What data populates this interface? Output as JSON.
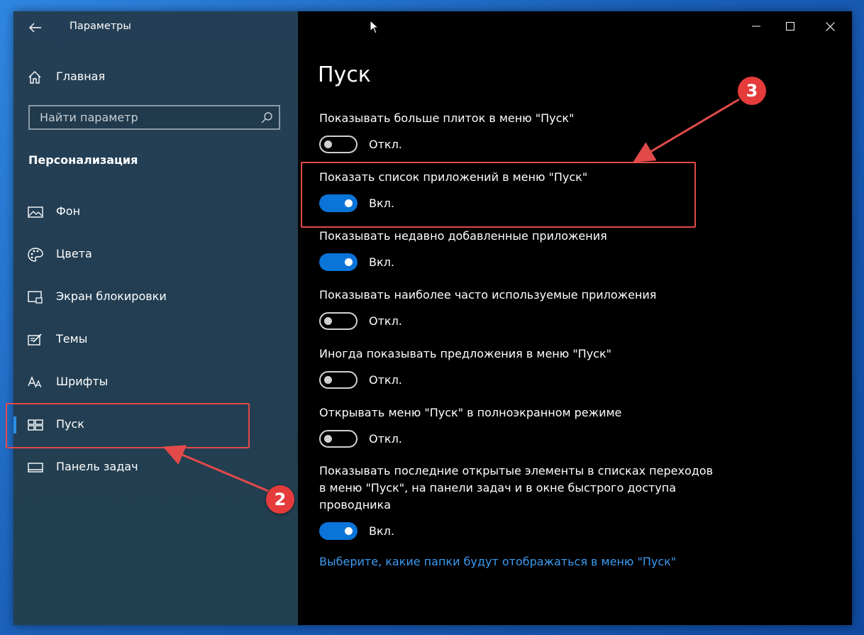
{
  "window": {
    "app_title": "Параметры",
    "minimize_icon": "minimize-icon",
    "maximize_icon": "maximize-icon",
    "close_icon": "close-icon"
  },
  "sidebar": {
    "home_label": "Главная",
    "search_placeholder": "Найти параметр",
    "section_title": "Персонализация",
    "items": [
      {
        "label": "Фон",
        "icon": "picture-icon"
      },
      {
        "label": "Цвета",
        "icon": "palette-icon"
      },
      {
        "label": "Экран блокировки",
        "icon": "lock-screen-icon"
      },
      {
        "label": "Темы",
        "icon": "themes-icon"
      },
      {
        "label": "Шрифты",
        "icon": "fonts-icon"
      },
      {
        "label": "Пуск",
        "icon": "start-icon",
        "selected": true
      },
      {
        "label": "Панель задач",
        "icon": "taskbar-icon"
      }
    ]
  },
  "main": {
    "page_title": "Пуск",
    "settings": [
      {
        "label": "Показывать больше плиток в меню \"Пуск\"",
        "state": "Откл.",
        "on": false
      },
      {
        "label": "Показать список приложений в меню \"Пуск\"",
        "state": "Вкл.",
        "on": true
      },
      {
        "label": "Показывать недавно добавленные приложения",
        "state": "Вкл.",
        "on": true
      },
      {
        "label": "Показывать наиболее часто используемые приложения",
        "state": "Откл.",
        "on": false
      },
      {
        "label": "Иногда показывать предложения в меню \"Пуск\"",
        "state": "Откл.",
        "on": false
      },
      {
        "label": "Открывать меню \"Пуск\" в полноэкранном режиме",
        "state": "Откл.",
        "on": false
      },
      {
        "label": "Показывать последние открытые элементы в списках переходов в меню \"Пуск\", на панели задач и в окне быстрого доступа проводника",
        "state": "Вкл.",
        "on": true
      }
    ],
    "folders_link": "Выберите, какие папки будут отображаться в меню \"Пуск\""
  },
  "annotations": {
    "step2": "2",
    "step3": "3",
    "color": "#e24a4a"
  },
  "colors": {
    "accent": "#0a74d9",
    "link": "#3b9bf2",
    "sidebar_bg": "#243f55"
  }
}
